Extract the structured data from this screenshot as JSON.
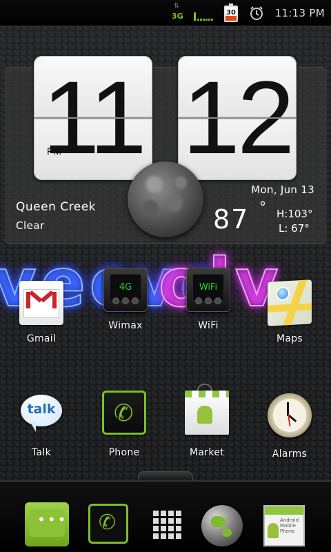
{
  "status_bar": {
    "network": "3G",
    "battery": "30",
    "time": "11:13 PM",
    "icons": [
      "data-arrows-icon",
      "signal-bars-icon",
      "battery-icon",
      "alarm-clock-icon"
    ]
  },
  "clock_widget": {
    "hours": "11",
    "minutes": "12",
    "ampm": "PM",
    "city": "Queen Creek",
    "condition": "Clear",
    "date": "Mon, Jun 13",
    "temperature": "87",
    "degree": "°",
    "high": "H:103°",
    "low": "L: 67°",
    "icon": "moon-icon"
  },
  "wallpaper": {
    "left_text": "vecvo",
    "right_text": "olv"
  },
  "apps_row1": [
    {
      "label": "Gmail",
      "icon": "gmail-icon"
    },
    {
      "label": "Wimax",
      "icon": "wimax-toggle-icon",
      "screen": "4G"
    },
    {
      "label": "WiFi",
      "icon": "wifi-toggle-icon",
      "screen": "WiFi"
    },
    {
      "label": "Maps",
      "icon": "maps-icon"
    }
  ],
  "apps_row2": [
    {
      "label": "Talk",
      "icon": "talk-icon",
      "badge": "talk"
    },
    {
      "label": "Phone",
      "icon": "phone-icon"
    },
    {
      "label": "Market",
      "icon": "market-icon"
    },
    {
      "label": "Alarms",
      "icon": "alarm-clock-icon"
    }
  ],
  "dock": {
    "items": [
      "messaging-icon",
      "phone-icon",
      "app-drawer-icon",
      "browser-globe-icon",
      "contacts-card-icon"
    ],
    "card_text": "Android Mobile Phone"
  },
  "colors": {
    "accent_green": "#7bbf2a",
    "neon_blue": "#8ab6ff",
    "neon_pink": "#f0a2ff"
  }
}
